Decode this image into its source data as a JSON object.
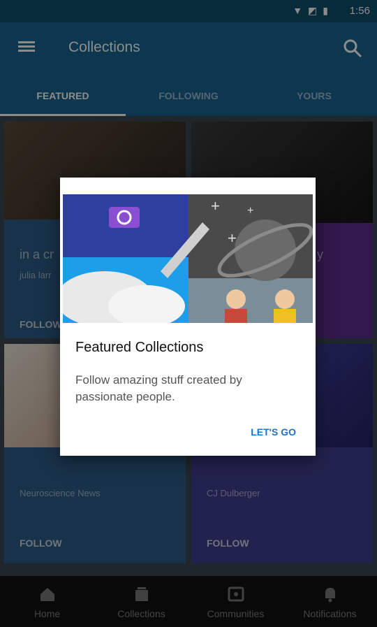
{
  "status_bar": {
    "time": "1:56",
    "icons": [
      "wifi-icon",
      "signal-icon",
      "battery-icon"
    ]
  },
  "app_bar": {
    "title": "Collections",
    "menu_icon": "menu-icon",
    "search_icon": "search-icon"
  },
  "tabs": [
    {
      "label": "FEATURED",
      "active": true
    },
    {
      "label": "FOLLOWING",
      "active": false
    },
    {
      "label": "YOURS",
      "active": false
    }
  ],
  "cards": [
    {
      "title": "in a cr",
      "subtitle": "julia larr",
      "follow": "FOLLOW"
    },
    {
      "title": "y",
      "subtitle": "",
      "follow": ""
    },
    {
      "title": "",
      "subtitle": "Neuroscience News",
      "follow": "FOLLOW"
    },
    {
      "title": "",
      "subtitle": "CJ Dulberger",
      "follow": "FOLLOW"
    }
  ],
  "modal": {
    "title": "Featured Collections",
    "body": "Follow amazing stuff created by passionate people.",
    "button": "LET'S GO"
  },
  "bottom_nav": [
    {
      "label": "Home",
      "icon": "home-icon"
    },
    {
      "label": "Collections",
      "icon": "collections-icon"
    },
    {
      "label": "Communities",
      "icon": "communities-icon"
    },
    {
      "label": "Notifications",
      "icon": "bell-icon"
    }
  ],
  "colors": {
    "primary": "#16648f",
    "status": "#0f4f6e",
    "accent": "#1a73c9"
  }
}
